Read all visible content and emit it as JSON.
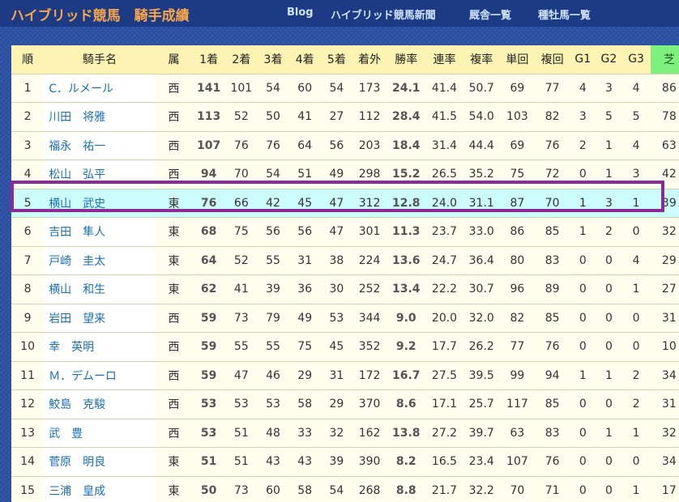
{
  "header": {
    "logo": "ハイブリッド競馬　騎手成績",
    "nav": [
      "Blog",
      "ハイブリッド競馬新聞",
      "厩舎一覧",
      "種牡馬一覧"
    ]
  },
  "table": {
    "columns": [
      "順",
      "騎手名",
      "属",
      "1着",
      "2着",
      "3着",
      "4着",
      "5着",
      "着外",
      "勝率",
      "連率",
      "複率",
      "単回",
      "複回",
      "G1",
      "G2",
      "G3",
      "芝"
    ],
    "rows": [
      {
        "rank": "1",
        "name": "C．ルメール",
        "affil": "西",
        "w1": "141",
        "w2": "101",
        "w3": "54",
        "w4": "60",
        "w5": "54",
        "out": "173",
        "win_rate": "24.1",
        "top2_rate": "41.4",
        "top3_rate": "50.7",
        "win_return": "69",
        "place_return": "77",
        "g1": "4",
        "g2": "3",
        "g3": "4",
        "turf": "86"
      },
      {
        "rank": "2",
        "name": "川田　将雅",
        "affil": "西",
        "w1": "113",
        "w2": "52",
        "w3": "50",
        "w4": "41",
        "w5": "27",
        "out": "112",
        "win_rate": "28.4",
        "top2_rate": "41.5",
        "top3_rate": "54.0",
        "win_return": "103",
        "place_return": "82",
        "g1": "3",
        "g2": "5",
        "g3": "5",
        "turf": "78"
      },
      {
        "rank": "3",
        "name": "福永　祐一",
        "affil": "西",
        "w1": "107",
        "w2": "76",
        "w3": "76",
        "w4": "64",
        "w5": "56",
        "out": "203",
        "win_rate": "18.4",
        "top2_rate": "31.4",
        "top3_rate": "44.4",
        "win_return": "69",
        "place_return": "76",
        "g1": "2",
        "g2": "1",
        "g3": "4",
        "turf": "63"
      },
      {
        "rank": "4",
        "name": "松山　弘平",
        "affil": "西",
        "w1": "94",
        "w2": "70",
        "w3": "54",
        "w4": "51",
        "w5": "49",
        "out": "298",
        "win_rate": "15.2",
        "top2_rate": "26.5",
        "top3_rate": "35.2",
        "win_return": "75",
        "place_return": "72",
        "g1": "0",
        "g2": "1",
        "g3": "3",
        "turf": "42"
      },
      {
        "rank": "5",
        "name": "横山　武史",
        "affil": "東",
        "w1": "76",
        "w2": "66",
        "w3": "42",
        "w4": "45",
        "w5": "47",
        "out": "312",
        "win_rate": "12.8",
        "top2_rate": "24.0",
        "top3_rate": "31.1",
        "win_return": "87",
        "place_return": "70",
        "g1": "1",
        "g2": "3",
        "g3": "1",
        "turf": "39"
      },
      {
        "rank": "6",
        "name": "吉田　隼人",
        "affil": "東",
        "w1": "68",
        "w2": "75",
        "w3": "56",
        "w4": "56",
        "w5": "47",
        "out": "301",
        "win_rate": "11.3",
        "top2_rate": "23.7",
        "top3_rate": "33.0",
        "win_return": "86",
        "place_return": "85",
        "g1": "1",
        "g2": "2",
        "g3": "0",
        "turf": "32"
      },
      {
        "rank": "7",
        "name": "戸崎　圭太",
        "affil": "東",
        "w1": "64",
        "w2": "52",
        "w3": "55",
        "w4": "31",
        "w5": "38",
        "out": "224",
        "win_rate": "13.6",
        "top2_rate": "24.7",
        "top3_rate": "36.4",
        "win_return": "80",
        "place_return": "83",
        "g1": "0",
        "g2": "0",
        "g3": "4",
        "turf": "29"
      },
      {
        "rank": "8",
        "name": "横山　和生",
        "affil": "東",
        "w1": "62",
        "w2": "41",
        "w3": "39",
        "w4": "36",
        "w5": "30",
        "out": "252",
        "win_rate": "13.4",
        "top2_rate": "22.2",
        "top3_rate": "30.7",
        "win_return": "96",
        "place_return": "89",
        "g1": "0",
        "g2": "0",
        "g3": "1",
        "turf": "27"
      },
      {
        "rank": "9",
        "name": "岩田　望来",
        "affil": "西",
        "w1": "59",
        "w2": "73",
        "w3": "79",
        "w4": "49",
        "w5": "53",
        "out": "344",
        "win_rate": "9.0",
        "top2_rate": "20.0",
        "top3_rate": "32.0",
        "win_return": "82",
        "place_return": "85",
        "g1": "0",
        "g2": "0",
        "g3": "0",
        "turf": "31"
      },
      {
        "rank": "10",
        "name": "幸　英明",
        "affil": "西",
        "w1": "59",
        "w2": "55",
        "w3": "55",
        "w4": "75",
        "w5": "45",
        "out": "352",
        "win_rate": "9.2",
        "top2_rate": "17.7",
        "top3_rate": "26.2",
        "win_return": "77",
        "place_return": "76",
        "g1": "0",
        "g2": "0",
        "g3": "0",
        "turf": "10"
      },
      {
        "rank": "11",
        "name": "Ｍ．デムーロ",
        "affil": "西",
        "w1": "59",
        "w2": "47",
        "w3": "46",
        "w4": "29",
        "w5": "31",
        "out": "172",
        "win_rate": "16.7",
        "top2_rate": "27.5",
        "top3_rate": "39.5",
        "win_return": "99",
        "place_return": "94",
        "g1": "1",
        "g2": "1",
        "g3": "2",
        "turf": "34"
      },
      {
        "rank": "12",
        "name": "鮫島　克駿",
        "affil": "西",
        "w1": "53",
        "w2": "53",
        "w3": "53",
        "w4": "58",
        "w5": "29",
        "out": "370",
        "win_rate": "8.6",
        "top2_rate": "17.1",
        "top3_rate": "25.7",
        "win_return": "117",
        "place_return": "85",
        "g1": "0",
        "g2": "0",
        "g3": "2",
        "turf": "31"
      },
      {
        "rank": "13",
        "name": "武　豊",
        "affil": "西",
        "w1": "53",
        "w2": "51",
        "w3": "48",
        "w4": "33",
        "w5": "32",
        "out": "162",
        "win_rate": "13.8",
        "top2_rate": "27.2",
        "top3_rate": "39.7",
        "win_return": "63",
        "place_return": "83",
        "g1": "0",
        "g2": "1",
        "g3": "1",
        "turf": "32"
      },
      {
        "rank": "14",
        "name": "菅原　明良",
        "affil": "東",
        "w1": "51",
        "w2": "51",
        "w3": "43",
        "w4": "43",
        "w5": "39",
        "out": "390",
        "win_rate": "8.2",
        "top2_rate": "16.5",
        "top3_rate": "23.4",
        "win_return": "107",
        "place_return": "76",
        "g1": "0",
        "g2": "0",
        "g3": "0",
        "turf": "34"
      },
      {
        "rank": "15",
        "name": "三浦　皇成",
        "affil": "東",
        "w1": "50",
        "w2": "73",
        "w3": "60",
        "w4": "58",
        "w5": "54",
        "out": "268",
        "win_rate": "8.8",
        "top2_rate": "21.7",
        "top3_rate": "32.2",
        "win_return": "70",
        "place_return": "71",
        "g1": "0",
        "g2": "0",
        "g3": "1",
        "turf": "17"
      }
    ]
  }
}
